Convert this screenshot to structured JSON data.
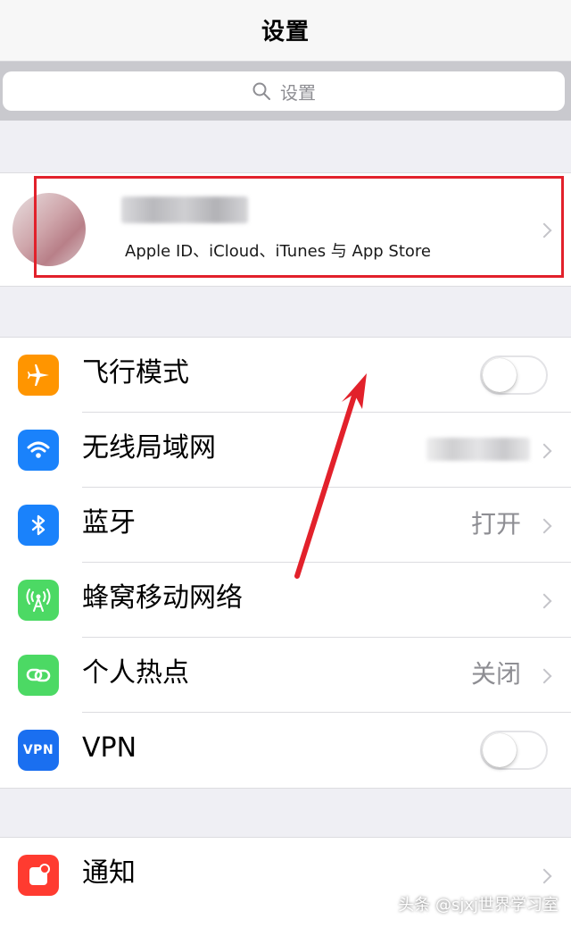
{
  "header": {
    "title": "设置"
  },
  "search": {
    "placeholder": "设置"
  },
  "profile": {
    "subtitle": "Apple ID、iCloud、iTunes 与 App Store"
  },
  "settings": [
    {
      "label": "飞行模式",
      "icon": "airplane-icon",
      "color": "#ff9500",
      "control": "toggle",
      "on": false
    },
    {
      "label": "无线局域网",
      "icon": "wifi-icon",
      "color": "#1a82fb",
      "control": "chevron"
    },
    {
      "label": "蓝牙",
      "icon": "bluetooth-icon",
      "color": "#1a82fb",
      "value": "打开",
      "control": "chevron"
    },
    {
      "label": "蜂窝移动网络",
      "icon": "cellular-icon",
      "color": "#4cd964",
      "control": "chevron"
    },
    {
      "label": "个人热点",
      "icon": "hotspot-icon",
      "color": "#4cd964",
      "value": "关闭",
      "control": "chevron"
    },
    {
      "label": "VPN",
      "icon": "vpn-icon",
      "icon_text": "VPN",
      "color": "#1a6ff0",
      "control": "toggle",
      "on": false
    }
  ],
  "notifications": {
    "label": "通知",
    "icon": "notifications-icon",
    "color": "#ff3b30"
  },
  "watermark": "头条 @sjxj世界学习室",
  "annotation_color": "#e2212b"
}
